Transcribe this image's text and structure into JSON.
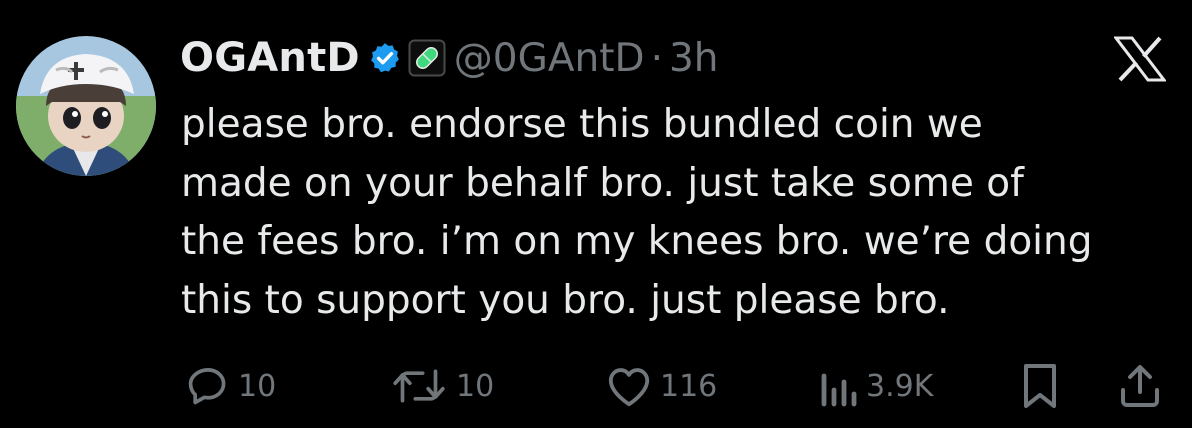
{
  "tweet": {
    "display_name": "OGAntD",
    "handle": "@0GAntD",
    "separator": "·",
    "time": "3h",
    "text_lines": [
      "please bro. endorse this bundled coin we",
      "made on your behalf bro. just take some of",
      "the fees bro. i’m on my knees bro. we’re doing",
      "this to support you bro. just please bro."
    ]
  },
  "actions": {
    "replies": "10",
    "reposts": "10",
    "likes": "116",
    "views": "3.9K"
  },
  "icons": {
    "verified": "verified-badge-icon",
    "badge": "green-pill-icon",
    "platform": "x-logo-icon",
    "reply": "reply-icon",
    "repost": "repost-icon",
    "like": "like-icon",
    "views": "views-icon",
    "bookmark": "bookmark-icon",
    "share": "share-icon"
  },
  "colors": {
    "background": "#000000",
    "text": "#e7e9ea",
    "secondary": "#71767b",
    "verified": "#1d9bf0",
    "pill": "#3fd87c"
  }
}
